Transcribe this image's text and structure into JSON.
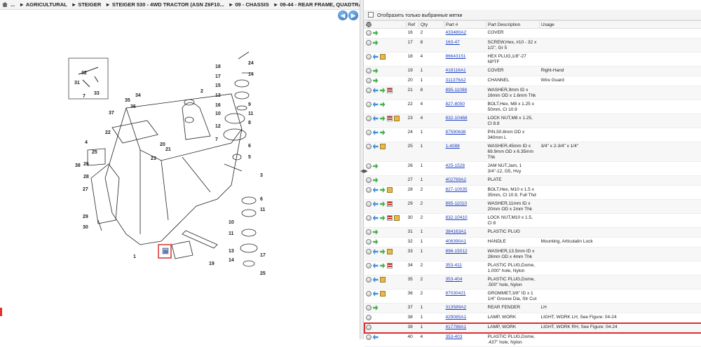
{
  "breadcrumb": [
    "...",
    "AGRICULTURAL",
    "STEIGER",
    "STEIGER 530 - 4WD TRACTOR (ASN Z6F10...",
    "09 - CHASSIS",
    "09-44 - REAR FRAME, QUADTRAC TRACTOR"
  ],
  "nav": {
    "back": "◀",
    "forward": "▶"
  },
  "filter_label": "Отобразить только выбранные метки",
  "columns": {
    "ref": "Ref",
    "qty": "Qty",
    "part": "Part #",
    "desc": "Part Description",
    "usage": "Usage"
  },
  "callouts": [
    "18",
    "24",
    "17",
    "14",
    "15",
    "13",
    "16",
    "2",
    "9",
    "10",
    "11",
    "12",
    "8",
    "6",
    "5",
    "7",
    "4",
    "3",
    "34",
    "35",
    "36",
    "37",
    "22",
    "20",
    "21",
    "23",
    "25",
    "26",
    "27",
    "28",
    "29",
    "30",
    "31",
    "32",
    "33",
    "38",
    "1",
    "19",
    "39",
    "6",
    "10",
    "11",
    "13",
    "14",
    "17",
    "25"
  ],
  "rows": [
    {
      "ref": "16",
      "qty": "2",
      "part": "433480A2",
      "desc": "COVER",
      "usage": "",
      "icons": [
        "zoom",
        "arrow"
      ]
    },
    {
      "ref": "17",
      "qty": "8",
      "part": "163-47",
      "desc": "SCREW,Hex, #10 - 32 x 1/2\", Gr 5",
      "usage": "",
      "icons": [
        "zoom",
        "arrow"
      ]
    },
    {
      "ref": "18",
      "qty": "4",
      "part": "86643151",
      "desc": "HEX PLUG,1/8\"-27 NPTF",
      "usage": "",
      "icons": [
        "zoom",
        "back",
        "box"
      ]
    },
    {
      "ref": "19",
      "qty": "1",
      "part": "418116A1",
      "desc": "COVER",
      "usage": "Right-Hand",
      "icons": [
        "zoom",
        "arrow"
      ]
    },
    {
      "ref": "20",
      "qty": "1",
      "part": "311376A2",
      "desc": "CHANNEL",
      "usage": "Wire Guard",
      "icons": [
        "zoom",
        "arrow"
      ]
    },
    {
      "ref": "21",
      "qty": "8",
      "part": "895-11098",
      "desc": "WASHER,9mm ID x 16mm OD x 1.6mm Thk",
      "usage": "",
      "icons": [
        "zoom",
        "back",
        "arrow",
        "book"
      ]
    },
    {
      "ref": "22",
      "qty": "4",
      "part": "827-8050",
      "desc": "BOLT,Hex, M8 x 1.25 x 50mm, Cl 10.9",
      "usage": "",
      "icons": [
        "zoom",
        "back",
        "arrow"
      ]
    },
    {
      "ref": "23",
      "qty": "4",
      "part": "832-10468",
      "desc": "LOCK NUT,M8 x 1.25, Cl 8.8",
      "usage": "",
      "icons": [
        "zoom",
        "back",
        "arrow",
        "book",
        "box"
      ]
    },
    {
      "ref": "24",
      "qty": "1",
      "part": "87590638",
      "desc": "PIN,50.8mm OD x 340mm L",
      "usage": "",
      "icons": [
        "zoom",
        "back",
        "arrow"
      ]
    },
    {
      "ref": "25",
      "qty": "1",
      "part": "1-4088",
      "desc": "WASHER,45mm ID x 69.9mm OD x 6.35mm Thk",
      "usage": "3/4\" x 2-3/4\" x 1/4\"",
      "icons": [
        "zoom",
        "back",
        "box"
      ]
    },
    {
      "ref": "26",
      "qty": "1",
      "part": "425-1528",
      "desc": "JAM NUT,Jam, 1 3/4\"-12, G5, Hvy",
      "usage": "",
      "icons": [
        "zoom",
        "arrow"
      ]
    },
    {
      "ref": "27",
      "qty": "1",
      "part": "402769A2",
      "desc": "PLATE",
      "usage": "",
      "icons": [
        "zoom",
        "arrow"
      ]
    },
    {
      "ref": "28",
      "qty": "2",
      "part": "827-10035",
      "desc": "BOLT,Hex, M10 x 1.5 x 35mm, Cl 10.9, Full Thd",
      "usage": "",
      "icons": [
        "zoom",
        "back",
        "arrow",
        "box"
      ]
    },
    {
      "ref": "29",
      "qty": "2",
      "part": "895-11010",
      "desc": "WASHER,11mm ID x 20mm OD x 2mm Thk",
      "usage": "",
      "icons": [
        "zoom",
        "back",
        "arrow",
        "book"
      ]
    },
    {
      "ref": "30",
      "qty": "2",
      "part": "832-10410",
      "desc": "LOCK NUT,M10 x 1.5, Cl 8",
      "usage": "",
      "icons": [
        "zoom",
        "back",
        "arrow",
        "book",
        "box"
      ]
    },
    {
      "ref": "31",
      "qty": "1",
      "part": "384163A1",
      "desc": "PLASTIC PLUG",
      "usage": "",
      "icons": [
        "zoom",
        "arrow"
      ]
    },
    {
      "ref": "32",
      "qty": "1",
      "part": "406390A1",
      "desc": "HANDLE",
      "usage": "Mounting, Articulatin Lock",
      "icons": [
        "zoom",
        "arrow"
      ]
    },
    {
      "ref": "33",
      "qty": "1",
      "part": "896-15012",
      "desc": "WASHER,13.5mm ID x 28mm OD x 4mm Thk",
      "usage": "",
      "icons": [
        "zoom",
        "back",
        "arrow",
        "box"
      ]
    },
    {
      "ref": "34",
      "qty": "2",
      "part": "353-411",
      "desc": "PLASTIC PLUG,Dome, 1.000\" hole, Nylon",
      "usage": "",
      "icons": [
        "zoom",
        "back",
        "arrow",
        "book"
      ]
    },
    {
      "ref": "35",
      "qty": "2",
      "part": "353-404",
      "desc": "PLASTIC PLUG,Dome, .500\" hole, Nylon",
      "usage": "",
      "icons": [
        "zoom",
        "back",
        "box"
      ]
    },
    {
      "ref": "36",
      "qty": "2",
      "part": "87030421",
      "desc": "GROMMET,3/8\" ID x 1 1/4\" Groove Dia, Str Cut",
      "usage": "",
      "icons": [
        "zoom",
        "back",
        "box"
      ]
    },
    {
      "ref": "37",
      "qty": "1",
      "part": "313589A2",
      "desc": "REAR FENDER",
      "usage": "LH",
      "icons": [
        "zoom",
        "arrow"
      ]
    },
    {
      "ref": "38",
      "qty": "1",
      "part": "429085A1",
      "desc": "LAMP, WORK",
      "usage": "LIGHT, WORK LH, See Figure: 04-24",
      "icons": [
        "zoom"
      ]
    },
    {
      "ref": "39",
      "qty": "1",
      "part": "417788A1",
      "desc": "LAMP, WORK",
      "usage": "LIGHT, WORK RH, See Figure: 04-24",
      "icons": [
        "zoom"
      ],
      "selected": true
    },
    {
      "ref": "40",
      "qty": "4",
      "part": "353-403",
      "desc": "PLASTIC PLUG,Dome, .437\" hole, Nylon",
      "usage": "",
      "icons": [
        "zoom",
        "back"
      ]
    }
  ],
  "colors": {
    "link": "#1a3fc0",
    "selected_outline": "#d93030"
  }
}
